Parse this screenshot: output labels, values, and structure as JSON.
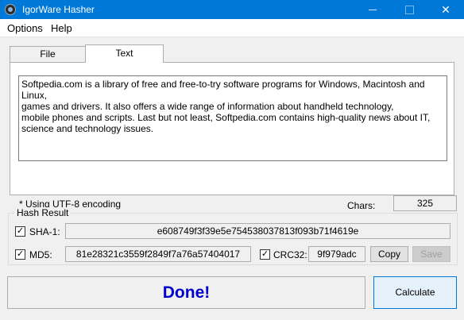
{
  "window": {
    "title": "IgorWare Hasher",
    "minimize_glyph": "",
    "close_glyph": "✕"
  },
  "menu": {
    "options": "Options",
    "help": "Help"
  },
  "tabs": {
    "file": "File",
    "text": "Text",
    "active": "Text"
  },
  "text_panel": {
    "content": "Softpedia.com is a library of free and free-to-try software programs for Windows, Macintosh and Linux,\ngames and drivers. It also offers a wide range of information about handheld technology,\nmobile phones and scripts. Last but not least, Softpedia.com contains high-quality news about IT,\nscience and technology issues.",
    "encoding_note": "* Using UTF-8 encoding",
    "chars_label": "Chars:",
    "chars_value": "325"
  },
  "hash_result": {
    "title": "Hash Result",
    "sha1": {
      "label": "SHA-1:",
      "checked": true,
      "value": "e608749f3f39e5e754538037813f093b71f4619e"
    },
    "md5": {
      "label": "MD5:",
      "checked": true,
      "value": "81e28321c3559f2849f7a76a57404017"
    },
    "crc32": {
      "label": "CRC32:",
      "checked": true,
      "value": "9f979adc"
    },
    "check_glyph": "✓",
    "copy_label": "Copy",
    "save_label": "Save"
  },
  "status": {
    "message": "Done!",
    "color": "#0000cc"
  },
  "calculate_label": "Calculate",
  "colors": {
    "titlebar": "#0078d7",
    "accent_border": "#0078d7"
  }
}
